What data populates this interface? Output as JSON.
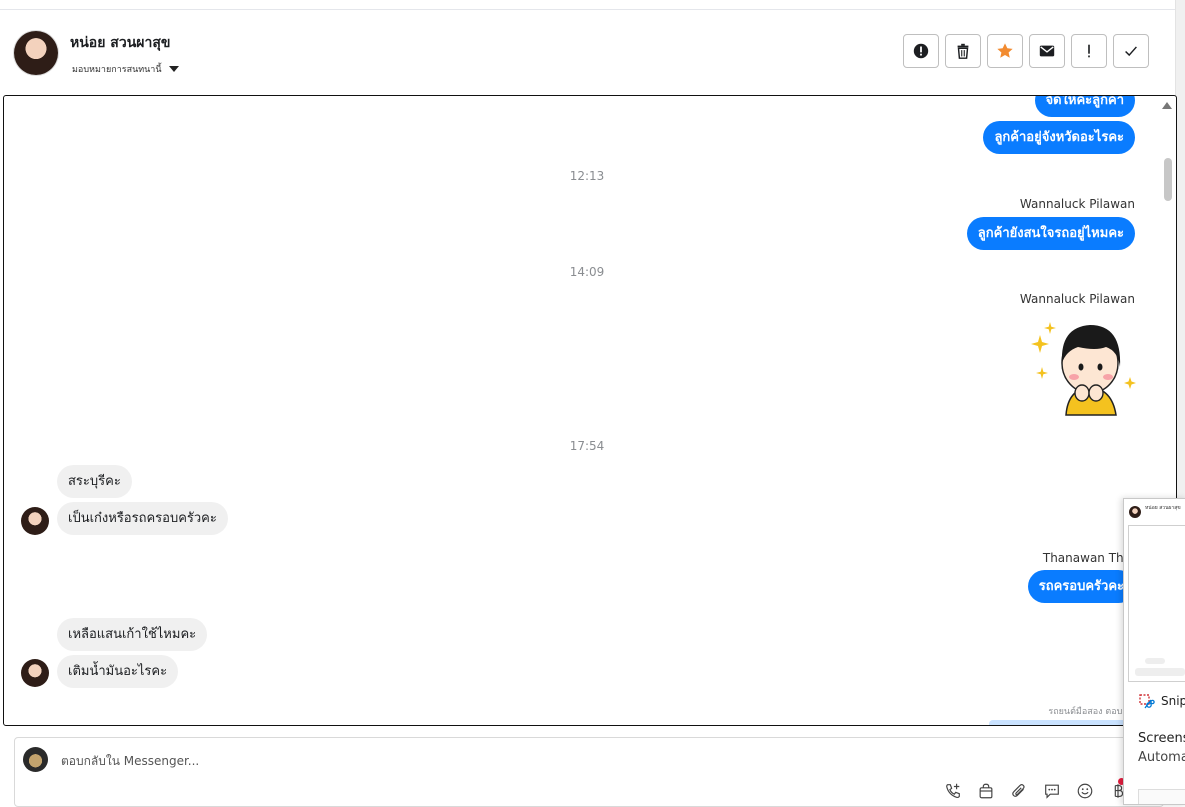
{
  "header": {
    "contact_name": "หน่อย สวนผาสุข",
    "assign_label": "มอบหมายการสนทนานี้"
  },
  "toolbar": {
    "buttons": [
      "alert-circle-icon",
      "trash-icon",
      "star-icon",
      "envelope-icon",
      "exclamation-icon",
      "check-icon"
    ],
    "star_color": "#f28b30"
  },
  "chat": {
    "messages": {
      "out_partial": "จัดให้ค่ะลูกค้า",
      "out_province": "ลูกค้าอยู่จังหวัดอะไรคะ",
      "time_1": "12:13",
      "sender_1": "Wannaluck Pilawan",
      "out_still_interested": "ลูกค้ายังสนใจรถอยู่ไหมคะ",
      "time_2": "14:09",
      "sender_2": "Wannaluck Pilawan",
      "time_3": "17:54",
      "in_which_car": "สระบุรีคะ",
      "in_sedan_or_family": "เป็นเก๋งหรือรถครอบครัวคะ",
      "sender_3": "Thanawan Tho",
      "out_family_car": "รถครอบครัวคะ",
      "in_leftover": "เหลือแสนเก้าใช้ไหมคะ",
      "in_fuel": "เติมน้ำมันอะไรคะ"
    },
    "reply_hint": "รถยนต์มือสอง ตอบกลับ หน่"
  },
  "composer": {
    "placeholder": "ตอบกลับใน Messenger..."
  },
  "overlay": {
    "mini_title": "หน่อย สวนผาสุข",
    "snip_label": "Snip",
    "screens_label": "Screens",
    "autom_label": "Automa"
  },
  "colors": {
    "outgoing_bubble": "#0a7cff",
    "incoming_bubble": "#f0f0f0",
    "notification": "#e41e3f"
  }
}
